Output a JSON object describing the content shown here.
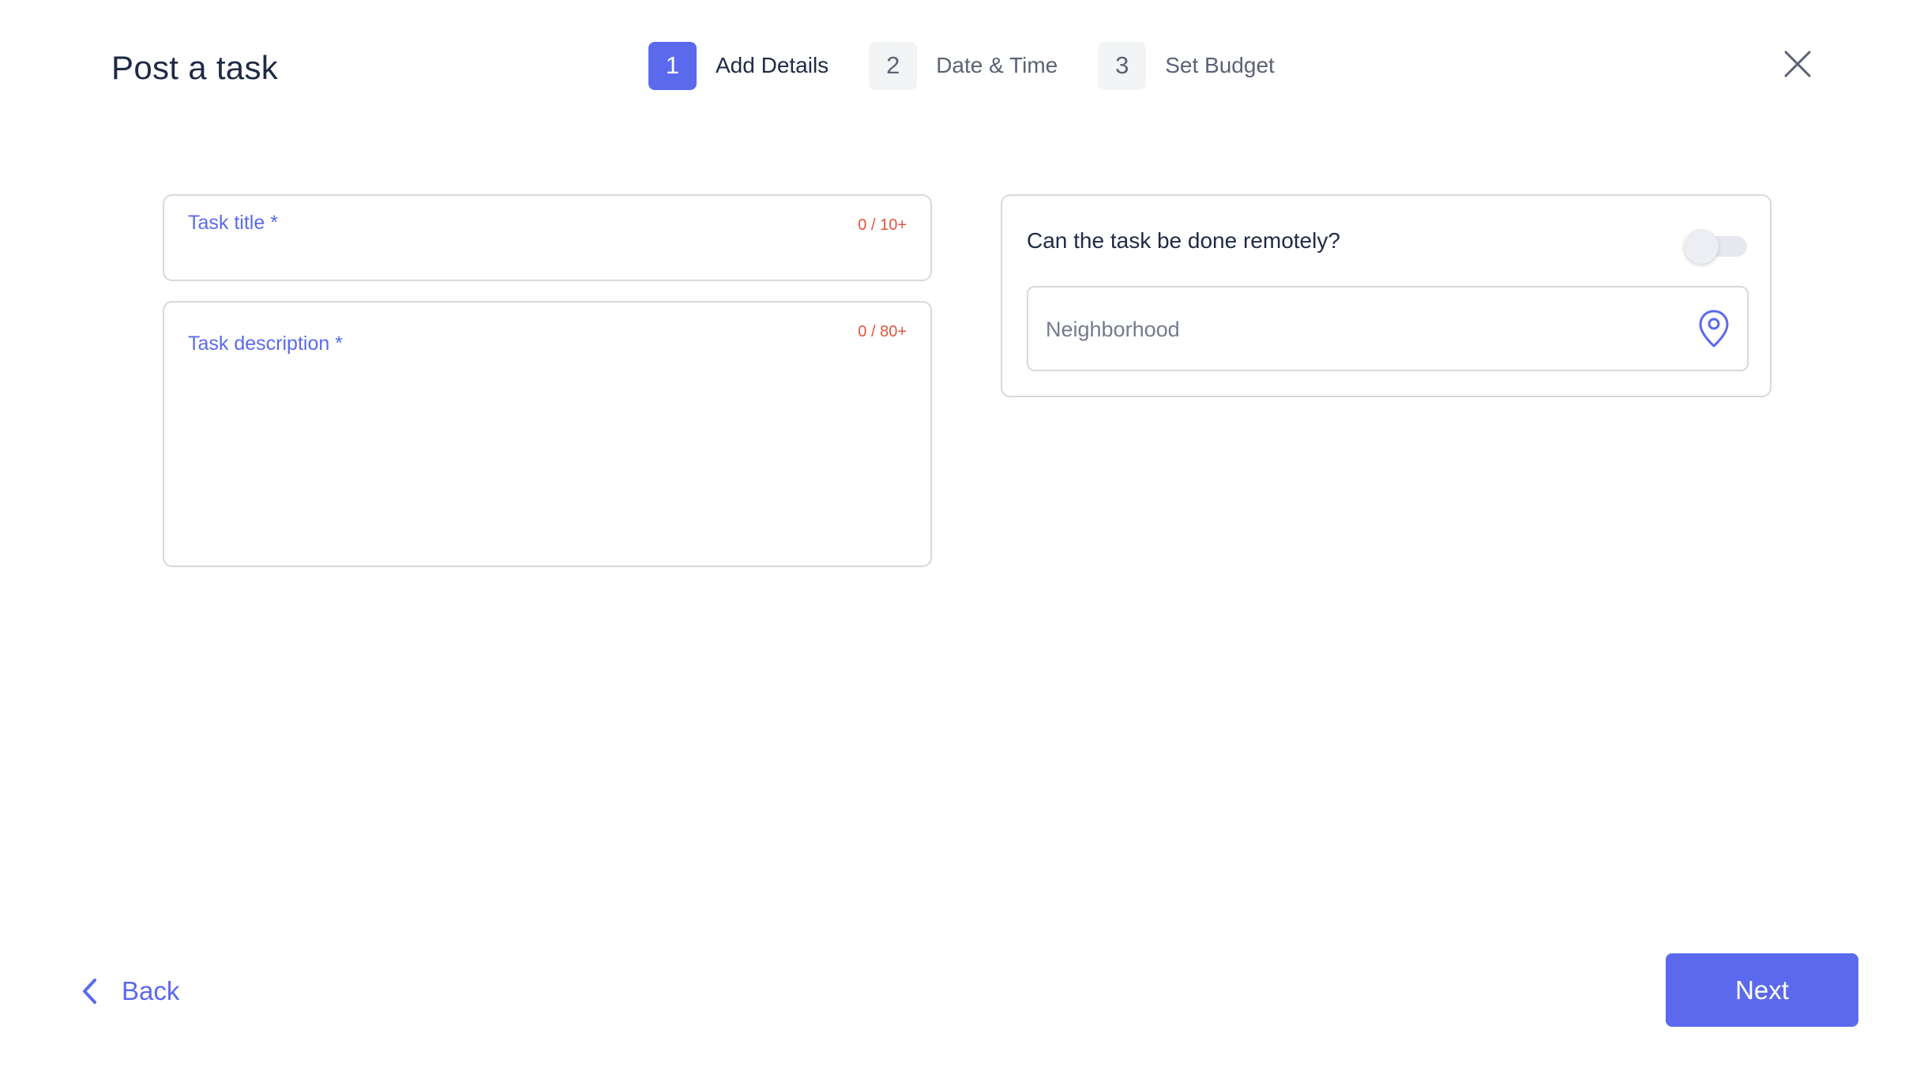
{
  "header": {
    "title": "Post a task",
    "steps": [
      {
        "number": "1",
        "label": "Add Details",
        "active": true
      },
      {
        "number": "2",
        "label": "Date & Time",
        "active": false
      },
      {
        "number": "3",
        "label": "Set Budget",
        "active": false
      }
    ],
    "close_icon": "close-icon"
  },
  "form": {
    "title_field": {
      "label": "Task title *",
      "counter": "0 / 10+",
      "value": ""
    },
    "description_field": {
      "label": "Task description  *",
      "counter": "0 / 80+",
      "value": ""
    },
    "remote": {
      "question": "Can the task be done remotely?",
      "enabled": false,
      "neighborhood_placeholder": "Neighborhood",
      "neighborhood_value": "",
      "location_icon": "map-pin-icon"
    }
  },
  "footer": {
    "back_label": "Back",
    "back_icon": "chevron-left-icon",
    "next_label": "Next"
  },
  "colors": {
    "accent": "#5b6aed",
    "counter": "#e0563d",
    "text": "#1f2a44",
    "muted": "#5b6275",
    "border": "#d7d9de"
  }
}
